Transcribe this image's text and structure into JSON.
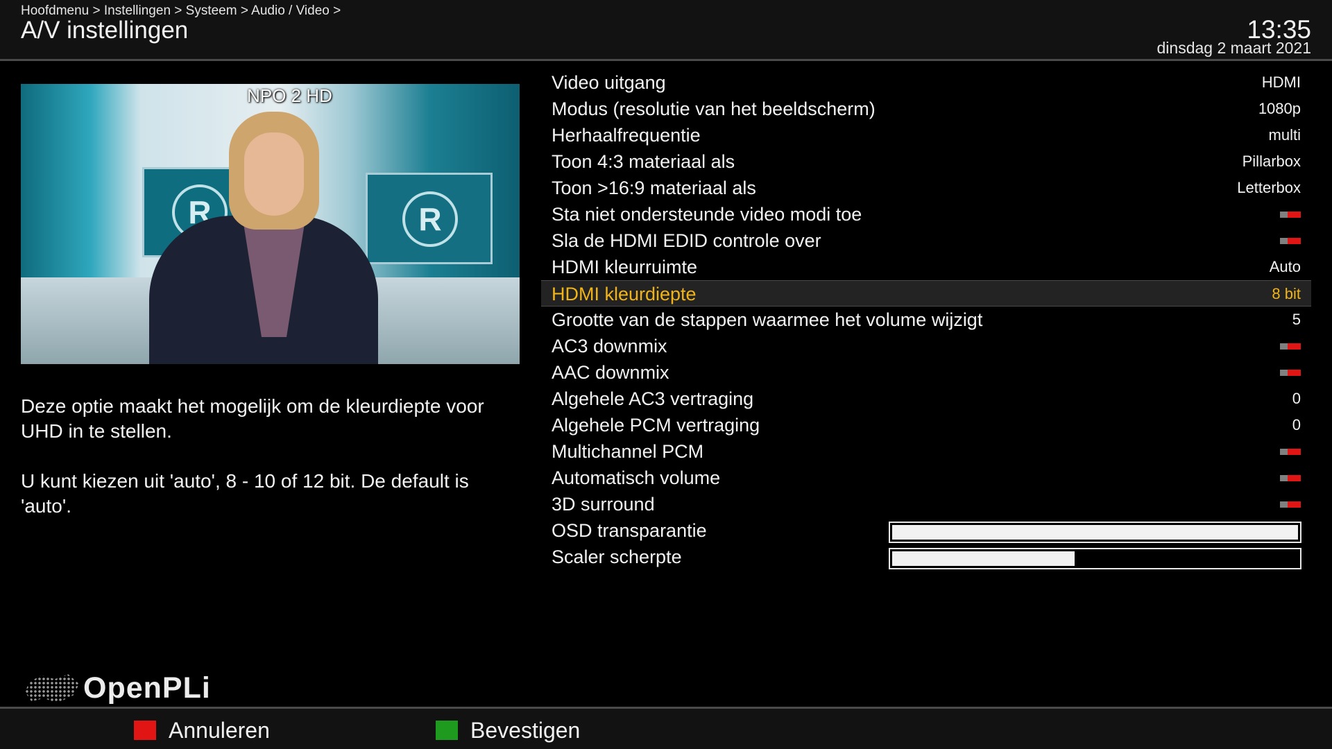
{
  "header": {
    "breadcrumb": "Hoofdmenu > Instellingen > Systeem > Audio / Video >",
    "title": "A/V instellingen",
    "time": "13:35",
    "date": "dinsdag  2 maart 2021"
  },
  "preview": {
    "channel": "NPO 2 HD"
  },
  "help": {
    "text": "Deze optie maakt het mogelijk om de kleurdiepte voor UHD in te stellen.\n\nU kunt kiezen uit 'auto', 8 - 10 of 12 bit. De default is 'auto'."
  },
  "settings": [
    {
      "label": "Video uitgang",
      "value": "HDMI"
    },
    {
      "label": "Modus (resolutie van het beeldscherm)",
      "value": "1080p"
    },
    {
      "label": "Herhaalfrequentie",
      "value": "multi"
    },
    {
      "label": "Toon 4:3 materiaal als",
      "value": "Pillarbox"
    },
    {
      "label": "Toon >16:9 materiaal als",
      "value": "Letterbox"
    },
    {
      "label": "Sta niet ondersteunde video modi toe",
      "toggle": "off"
    },
    {
      "label": "Sla de HDMI EDID controle over",
      "toggle": "off"
    },
    {
      "label": "HDMI kleurruimte",
      "value": "Auto"
    },
    {
      "label": "HDMI kleurdiepte",
      "value": "8 bit",
      "selected": true
    },
    {
      "label": "Grootte van de stappen waarmee het volume wijzigt",
      "value": "5"
    },
    {
      "label": "AC3 downmix",
      "toggle": "off"
    },
    {
      "label": "AAC downmix",
      "toggle": "off"
    },
    {
      "label": "Algehele AC3 vertraging",
      "value": "0"
    },
    {
      "label": "Algehele PCM vertraging",
      "value": "0"
    },
    {
      "label": "Multichannel PCM",
      "toggle": "off"
    },
    {
      "label": "Automatisch volume",
      "toggle": "off"
    },
    {
      "label": "3D surround",
      "toggle": "off"
    },
    {
      "label": "OSD transparantie",
      "slider_level": 1.0
    },
    {
      "label": "Scaler scherpte",
      "slider_level": 0.45
    }
  ],
  "branding": {
    "logo_text": "OpenPLi"
  },
  "footer": {
    "red_label": "Annuleren",
    "green_label": "Bevestigen"
  },
  "colors": {
    "highlight": "#f0b418",
    "red_key": "#e21515",
    "green_key": "#1e9b1e",
    "toggle_off_red": "#e21515"
  }
}
